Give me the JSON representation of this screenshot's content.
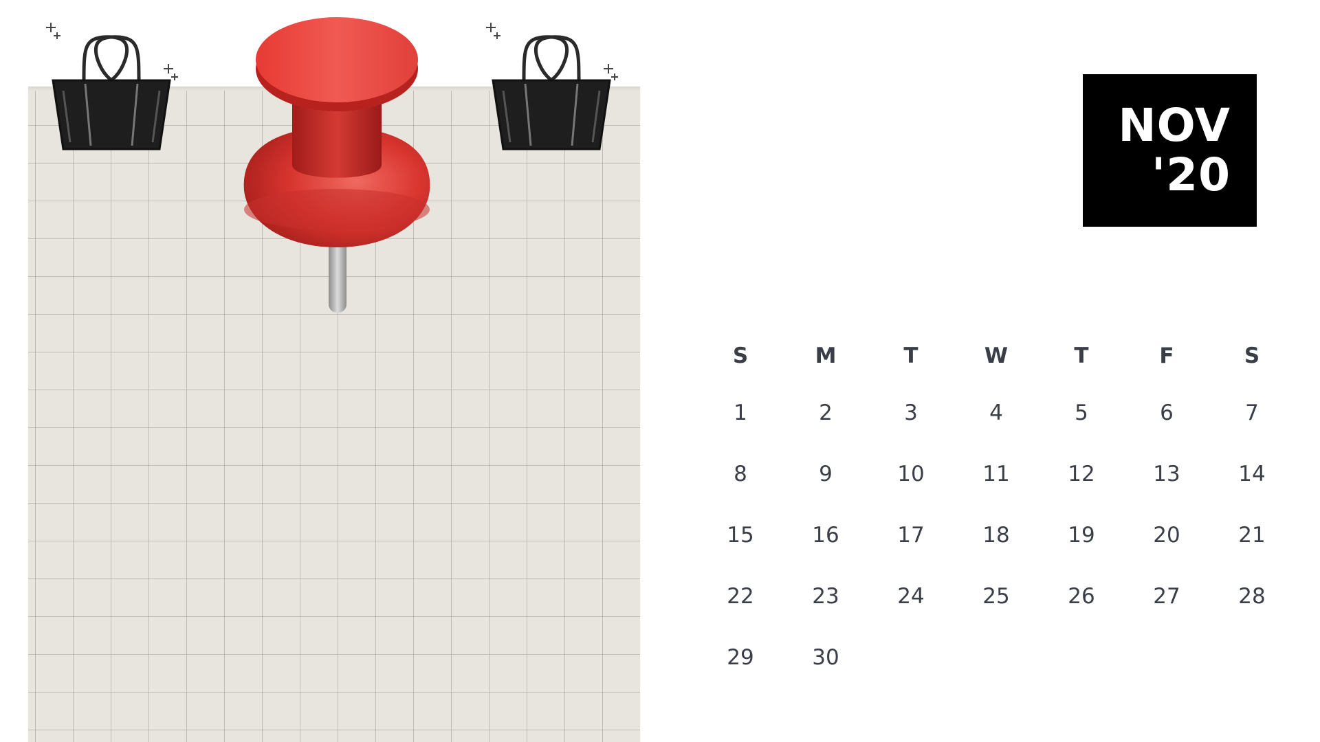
{
  "badge": {
    "month": "NOV",
    "year": "'20"
  },
  "calendar": {
    "weekdays": [
      "S",
      "M",
      "T",
      "W",
      "T",
      "F",
      "S"
    ],
    "weeks": [
      [
        "1",
        "2",
        "3",
        "4",
        "5",
        "6",
        "7"
      ],
      [
        "8",
        "9",
        "10",
        "11",
        "12",
        "13",
        "14"
      ],
      [
        "15",
        "16",
        "17",
        "18",
        "19",
        "20",
        "21"
      ],
      [
        "22",
        "23",
        "24",
        "25",
        "26",
        "27",
        "28"
      ],
      [
        "29",
        "30",
        "",
        "",
        "",
        "",
        ""
      ]
    ]
  },
  "decor": {
    "binder_clip_icon": "binder-clip-icon",
    "push_pin_icon": "push-pin-icon",
    "pin_color": "#e2403a",
    "paper_color": "#e7e5dd",
    "badge_color": "#000000"
  }
}
